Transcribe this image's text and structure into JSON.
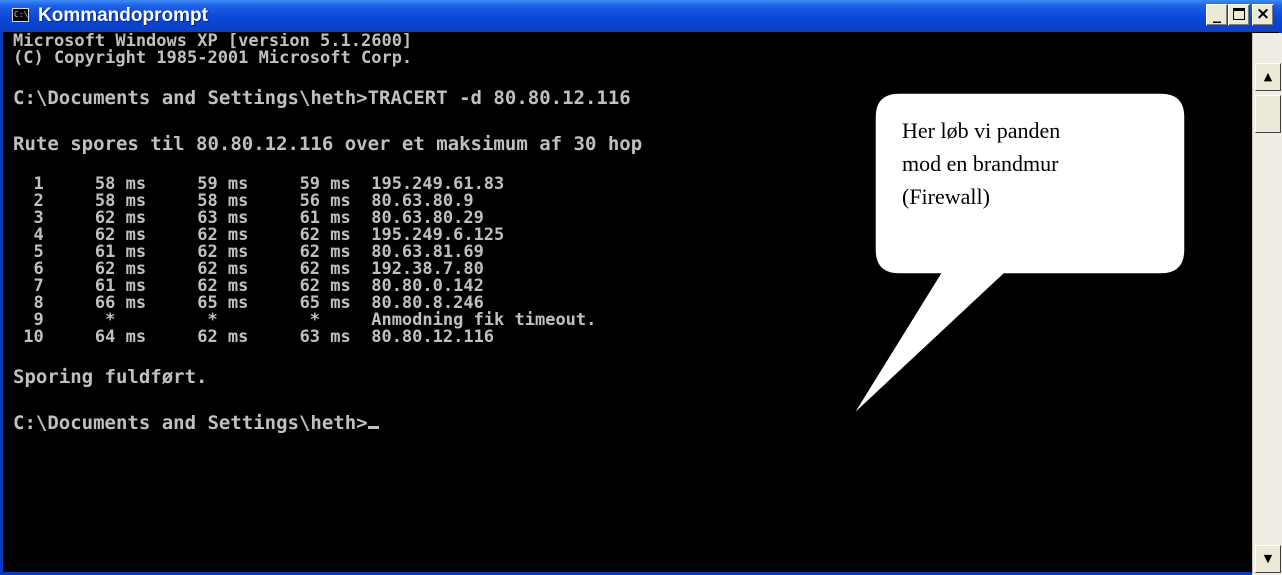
{
  "window": {
    "title": "Kommandoprompt",
    "icon": "console-icon",
    "icon_glyph": "C:\\",
    "buttons": {
      "minimize": "_",
      "close": "×"
    }
  },
  "console": {
    "lines": [
      "Microsoft Windows XP [version 5.1.2600]",
      "(C) Copyright 1985-2001 Microsoft Corp.",
      "",
      "C:\\Documents and Settings\\heth>TRACERT -d 80.80.12.116",
      "",
      "Rute spores til 80.80.12.116 over et maksimum af 30 hop",
      "",
      "  1     58 ms     59 ms     59 ms  195.249.61.83",
      "  2     58 ms     58 ms     56 ms  80.63.80.9",
      "  3     62 ms     63 ms     61 ms  80.63.80.29",
      "  4     62 ms     62 ms     62 ms  195.249.6.125",
      "  5     61 ms     62 ms     62 ms  80.63.81.69",
      "  6     62 ms     62 ms     62 ms  192.38.7.80",
      "  7     61 ms     62 ms     62 ms  80.80.0.142",
      "  8     66 ms     65 ms     65 ms  80.80.8.246",
      "  9      *         *         *     Anmodning fik timeout.",
      " 10     64 ms     62 ms     63 ms  80.80.12.116",
      "",
      "Sporing fuldført.",
      "",
      "C:\\Documents and Settings\\heth>"
    ]
  },
  "callout": {
    "lines": [
      "Her løb vi panden",
      "mod en brandmur",
      "(Firewall)"
    ]
  },
  "colors": {
    "titlebar": "#0a48d6",
    "console_bg": "#000000",
    "console_text": "#c0c0c0",
    "callout_bg": "#ffffff"
  },
  "scrollbar": {
    "up_icon": "arrow-up-icon",
    "down_icon": "arrow-down-icon"
  }
}
